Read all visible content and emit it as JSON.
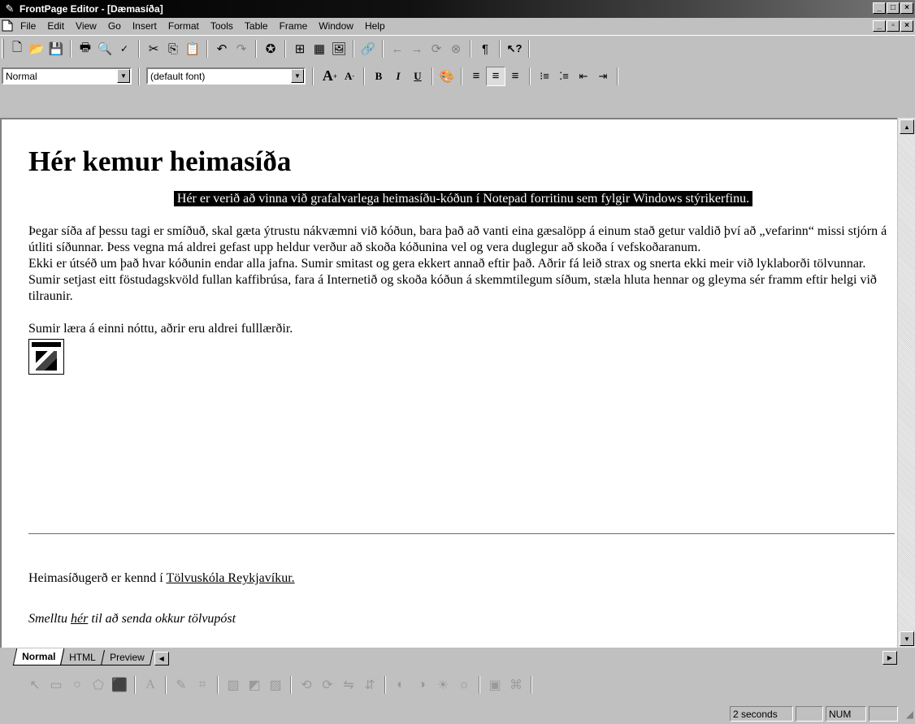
{
  "window": {
    "title": "FrontPage Editor - [Dæmasíða]",
    "controls": [
      "_",
      "□",
      "×"
    ],
    "doc_controls": [
      "_",
      "▫",
      "×"
    ]
  },
  "menubar": {
    "items": [
      "File",
      "Edit",
      "View",
      "Go",
      "Insert",
      "Format",
      "Tools",
      "Table",
      "Frame",
      "Window",
      "Help"
    ]
  },
  "format_toolbar": {
    "style_value": "Normal",
    "font_value": "(default font)"
  },
  "document": {
    "heading": "Hér kemur heimasíða",
    "highlight_text": "Hér er verið að vinna við grafalvarlega heimasíðu-kóðun í Notepad forritinu sem fylgir Windows stýrikerfinu.",
    "paragraph1": "Þegar síða af þessu tagi er smíðuð, skal gæta ýtrustu nákvæmni við kóðun, bara það að vanti eina gæsalöpp á einum stað getur valdið því að „vefarinn“ missi stjórn á útliti síðunnar. Þess vegna má aldrei gefast upp heldur verður að skoða kóðunina vel og vera duglegur að skoða í vefskoðaranum.",
    "paragraph2": "Ekki er útséð um það hvar kóðunin endar alla jafna. Sumir smitast og gera ekkert annað eftir það. Aðrir fá leið strax og snerta ekki meir við lyklaborði tölvunnar.",
    "paragraph3": "Sumir setjast eitt föstudagskvöld fullan kaffibrúsa, fara á Internetið og skoða kóðun á skemmtilegum síðum, stæla hluta hennar og gleyma sér framm eftir helgi við tilraunir.",
    "paragraph4": "Sumir læra á einni nóttu, aðrir eru aldrei fulllærðir.",
    "footer_prefix": "Heimasíðugerð er kennd í ",
    "footer_link": "Tölvuskóla Reykjavíkur.",
    "email_prefix": "Smelltu ",
    "email_link": "hér",
    "email_suffix": " til að senda okkur tölvupóst"
  },
  "tabs": [
    "Normal",
    "HTML",
    "Preview"
  ],
  "statusbar": {
    "time": "2 seconds",
    "num": "NUM"
  }
}
